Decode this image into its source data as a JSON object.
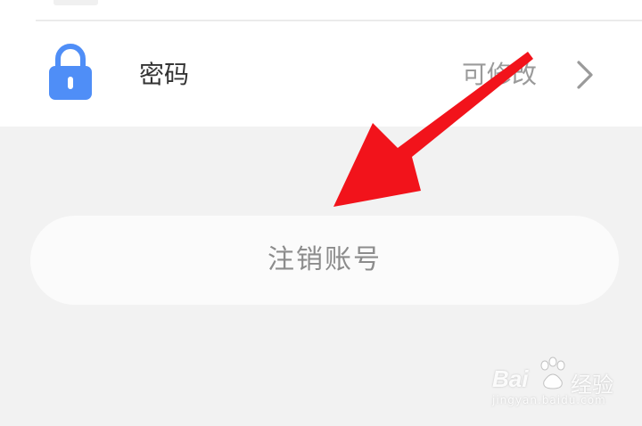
{
  "settings": {
    "password_row": {
      "label": "密码",
      "value": "可修改",
      "icon": "lock-icon",
      "icon_color": "#4f8ef7"
    }
  },
  "logout": {
    "label": "注销账号"
  },
  "overlay": {
    "arrow_color": "#f2131b"
  },
  "watermark": {
    "brand": "Bai",
    "brand_suffix": "经验",
    "url": "jingyan.baidu.com"
  }
}
